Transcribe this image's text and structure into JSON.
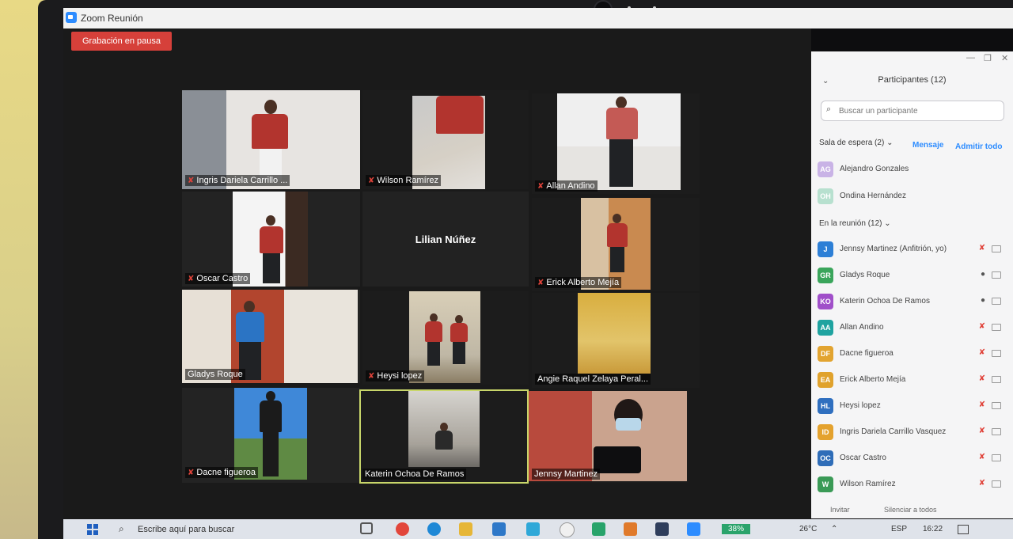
{
  "window": {
    "title": "Zoom Reunión"
  },
  "recording": {
    "label": "Grabación en pausa"
  },
  "tiles": [
    {
      "name": "Ingris Dariela Carrillo ...",
      "muted": true
    },
    {
      "name": "Wilson Ramírez",
      "muted": true
    },
    {
      "name": "Allan Andino",
      "muted": true
    },
    {
      "name": "Oscar Castro",
      "muted": true
    },
    {
      "name": "Lilian Núñez",
      "muted": false
    },
    {
      "name": "Erick Alberto Mejía",
      "muted": true
    },
    {
      "name": "Gladys Roque",
      "muted": false
    },
    {
      "name": "Heysi lopez",
      "muted": true
    },
    {
      "name": "Angie Raquel Zelaya Peral...",
      "muted": false
    },
    {
      "name": "Dacne figueroa",
      "muted": true
    },
    {
      "name": "Katerin Ochoa De Ramos",
      "muted": false
    },
    {
      "name": "Jennsy Martinez",
      "muted": false
    }
  ],
  "participants_panel": {
    "title": "Participantes (12)",
    "search_placeholder": "Buscar un participante",
    "waiting_room": {
      "label": "Sala de espera (2)",
      "message_label": "Mensaje",
      "admit_label": "Admitir todo",
      "people": [
        {
          "initials": "AG",
          "name": "Alejandro Gonzales",
          "color": "#c9b3e6"
        },
        {
          "initials": "OH",
          "name": "Ondina Hernández",
          "color": "#b7e0cf"
        }
      ]
    },
    "in_meeting": {
      "label": "En la reunión (12)",
      "people": [
        {
          "initials": "J",
          "name": "Jennsy Martinez (Anfitrión, yo)",
          "color": "#2d7fd6",
          "mic": "muted"
        },
        {
          "initials": "GR",
          "name": "Gladys Roque",
          "color": "#3aa55b",
          "mic": "on"
        },
        {
          "initials": "KO",
          "name": "Katerin Ochoa De Ramos",
          "color": "#a04fc9",
          "mic": "on"
        },
        {
          "initials": "AA",
          "name": "Allan Andino",
          "color": "#1fa3a0",
          "mic": "muted"
        },
        {
          "initials": "DF",
          "name": "Dacne figueroa",
          "color": "#e2a430",
          "mic": "muted"
        },
        {
          "initials": "EA",
          "name": "Erick Alberto Mejía",
          "color": "#e0a22c",
          "mic": "muted"
        },
        {
          "initials": "HL",
          "name": "Heysi lopez",
          "color": "#2f6fbf",
          "mic": "muted"
        },
        {
          "initials": "ID",
          "name": "Ingris Dariela Carrillo Vasquez",
          "color": "#e4a22e",
          "mic": "muted"
        },
        {
          "initials": "OC",
          "name": "Oscar Castro",
          "color": "#2f6db8",
          "mic": "muted"
        },
        {
          "initials": "W",
          "name": "Wilson Ramírez",
          "color": "#3a9a56",
          "mic": "muted"
        }
      ]
    },
    "invite_label": "Invitar",
    "mute_all_label": "Silenciar a todos"
  },
  "taskbar": {
    "search_text": "Escribe aquí para buscar",
    "battery": "38%",
    "temperature": "26°C",
    "language": "ESP",
    "time": "16:22"
  }
}
